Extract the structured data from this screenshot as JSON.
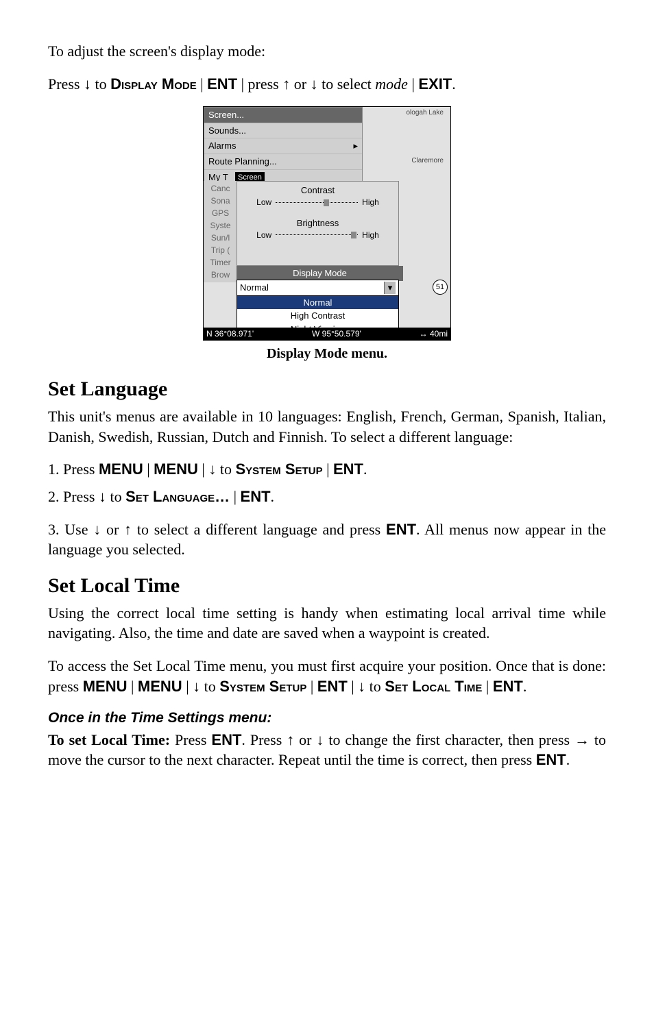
{
  "intro_line": "To adjust the screen's display mode:",
  "press_line": {
    "p1": "Press ",
    "arrow_down": "↓",
    "p2": " to ",
    "display_mode": "Display Mode",
    "sep1": " | ",
    "ent1": "ENT",
    "sep2": " | ",
    "p3": "press ",
    "arrow_up": "↑",
    "p4": " or ",
    "arrow_down2": "↓",
    "p5": " to select ",
    "mode_italic": "mode",
    "sep3": " | ",
    "exit": "EXIT",
    "dot": "."
  },
  "figure_caption": "Display Mode menu.",
  "screenshot": {
    "menu": [
      "Screen...",
      "Sounds...",
      "Alarms",
      "Route Planning...",
      "My T"
    ],
    "map_place1": "ologah Lake",
    "map_place2": "Claremore",
    "screen_chip": "Screen",
    "sidelist": [
      "Canc",
      "Sona",
      "GPS",
      "Syste",
      "Sun/l",
      "Trip (",
      "Timer",
      "Brow"
    ],
    "contrast": "Contrast",
    "brightness": "Brightness",
    "low": "Low",
    "high": "High",
    "display_mode_hdr": "Display Mode",
    "dd_selected": "Normal",
    "dd_items": [
      "Normal",
      "High Contrast",
      "Night Viewing"
    ],
    "status_lat": "N   36°08.971'",
    "status_lon": "W   95°50.579'",
    "scale": "40mi",
    "road": "51"
  },
  "set_language_h": "Set Language",
  "set_language_body": "This unit's menus are available in 10 languages: English, French, German, Spanish, Italian, Danish, Swedish, Russian, Dutch and Finnish. To select a different language:",
  "step1": {
    "pre": "1. Press ",
    "menu": "MENU",
    "sep": " | ",
    "menu2": "MENU",
    "sep2": " | ",
    "down": "↓",
    "to": " to ",
    "sys": "System Setup",
    "sep3": " | ",
    "ent": "ENT",
    "dot": "."
  },
  "step2": {
    "pre": "2. Press ",
    "down": "↓",
    "to": " to ",
    "setlang": "Set Language…",
    "sep": " | ",
    "ent": "ENT",
    "dot": "."
  },
  "step3": {
    "pre": "3. Use ",
    "down": "↓",
    "or": " or ",
    "up": "↑",
    "mid": " to select a different language and press ",
    "ent": "ENT",
    "tail": ". All menus now appear in the language you selected."
  },
  "set_local_h": "Set Local Time",
  "set_local_body": "Using the correct local time setting is handy when estimating local arrival time while navigating. Also, the time and date are saved when a waypoint is created.",
  "set_local_access": {
    "p1": "To access the Set Local Time menu, you must first acquire your position. Once that is done: press ",
    "menu": "MENU",
    "sep": " | ",
    "menu2": "MENU",
    "sep2": " | ",
    "down": "↓",
    "to": " to ",
    "sys": "System Setup",
    "sep3": " | ",
    "ent": "ENT",
    "sep4": " | ",
    "down2": "↓",
    "to2": " to ",
    "slt": "Set Local Time",
    "sep5": " | ",
    "ent2": "ENT",
    "dot": "."
  },
  "once_h": "Once in the Time Settings menu:",
  "to_set_local": {
    "lead": "To set Local Time:",
    "p1": " Press ",
    "ent": "ENT",
    "p2": ". Press ",
    "up": "↑",
    "or": " or ",
    "down": "↓",
    "p3": " to change the first character, then press ",
    "right": "→",
    "p4": " to move the cursor to the next character. Repeat until the time is correct, then press ",
    "ent2": "ENT",
    "dot": "."
  }
}
